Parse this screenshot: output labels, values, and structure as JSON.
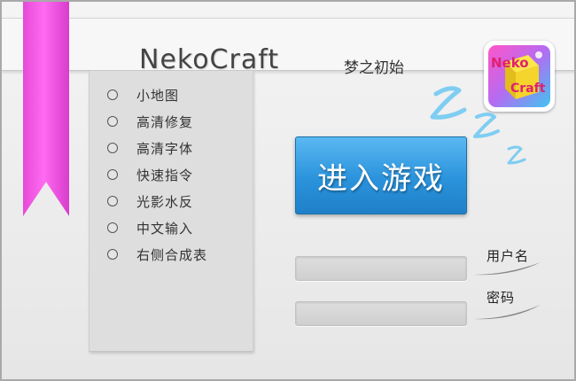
{
  "app": {
    "title": "NekoCraft",
    "subtitle": "梦之初始"
  },
  "logo": {
    "text_top": "Neko",
    "text_bottom": "Craft",
    "colors": [
      "#ff55c8",
      "#3fc5f0",
      "#f5dd2a",
      "#8a5cf0"
    ]
  },
  "options": [
    {
      "label": "小地图",
      "selected": false
    },
    {
      "label": "高清修复",
      "selected": false
    },
    {
      "label": "高清字体",
      "selected": false
    },
    {
      "label": "快速指令",
      "selected": false
    },
    {
      "label": "光影水反",
      "selected": false
    },
    {
      "label": "中文输入",
      "selected": false
    },
    {
      "label": "右侧合成表",
      "selected": false
    }
  ],
  "enter_button": {
    "label": "进入游戏"
  },
  "login": {
    "username_label": "用户名",
    "username_value": "",
    "password_label": "密码",
    "password_value": ""
  },
  "colors": {
    "ribbon": "#f257e4",
    "accent_blue": "#2a93dc",
    "zzz": "#7fcdf2"
  },
  "icons": {
    "ribbon": "bookmark-ribbon-icon",
    "zzz": "sleep-zzz-icon",
    "logo": "nekocraft-logo-icon"
  }
}
